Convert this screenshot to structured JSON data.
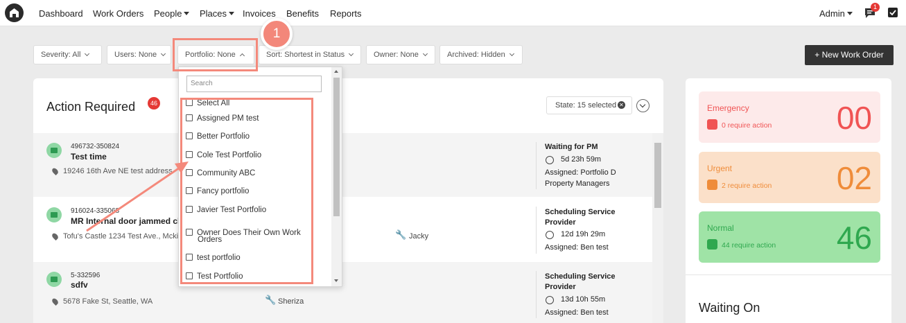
{
  "nav": {
    "items": [
      "Dashboard",
      "Work Orders",
      "People",
      "Places",
      "Invoices",
      "Benefits",
      "Reports"
    ],
    "admin_label": "Admin",
    "notification_count": "1"
  },
  "filters": {
    "severity": "Severity:  All",
    "users": "Users: None",
    "portfolio": "Portfolio: None",
    "sort": "Sort: Shortest in Status",
    "owner": "Owner: None",
    "archived": "Archived: Hidden"
  },
  "new_work_order_label": "+ New Work Order",
  "main": {
    "title": "Action Required",
    "count": "46",
    "state_chip": "State: 15 selected"
  },
  "rows": [
    {
      "id": "496732-350824",
      "title": "Test time",
      "address": "19246 16th Ave NE test address",
      "tech": "",
      "status": "Waiting for PM",
      "elapsed": "5d 23h 59m",
      "assigned_line1": "Assigned: Portfolio D",
      "assigned_line2": "Property Managers"
    },
    {
      "id": "916024-335068",
      "title": "MR Internal door jammed cl",
      "address": "Tofu's Castle 1234 Test Ave., Mckin",
      "tech": "Jacky",
      "status": "Scheduling Service",
      "status2": "Provider",
      "elapsed": "12d 19h 29m",
      "assigned_line1": "Assigned: Ben test"
    },
    {
      "id": "5-332596",
      "title": "sdfv",
      "address": "5678 Fake St, Seattle, WA",
      "tech": "Sheriza",
      "status": "Scheduling Service",
      "status2": "Provider",
      "elapsed": "13d 10h 55m",
      "assigned_line1": "Assigned: Ben test"
    }
  ],
  "dropdown": {
    "search_placeholder": "Search",
    "options": [
      "Select All",
      "Assigned PM test",
      "Better Portfolio",
      "Cole Test Portfolio",
      "Community ABC",
      "Fancy portfolio",
      "Javier Test Portfolio",
      "Owner Does Their Own Work",
      "Orders",
      "test portfolio",
      "Test Portfolio"
    ]
  },
  "step_number": "1",
  "severity_cards": [
    {
      "label": "Emergency",
      "sub": "0 require action",
      "count": "00",
      "color": "#f05454",
      "bg": "#fdeaea"
    },
    {
      "label": "Urgent",
      "sub": "2 require action",
      "count": "02",
      "color": "#ef8c3a",
      "bg": "#fbe0c9"
    },
    {
      "label": "Normal",
      "sub": "44 require action",
      "count": "46",
      "color": "#2fa84f",
      "bg": "#9fe3a6"
    }
  ],
  "waiting_on_title": "Waiting On"
}
